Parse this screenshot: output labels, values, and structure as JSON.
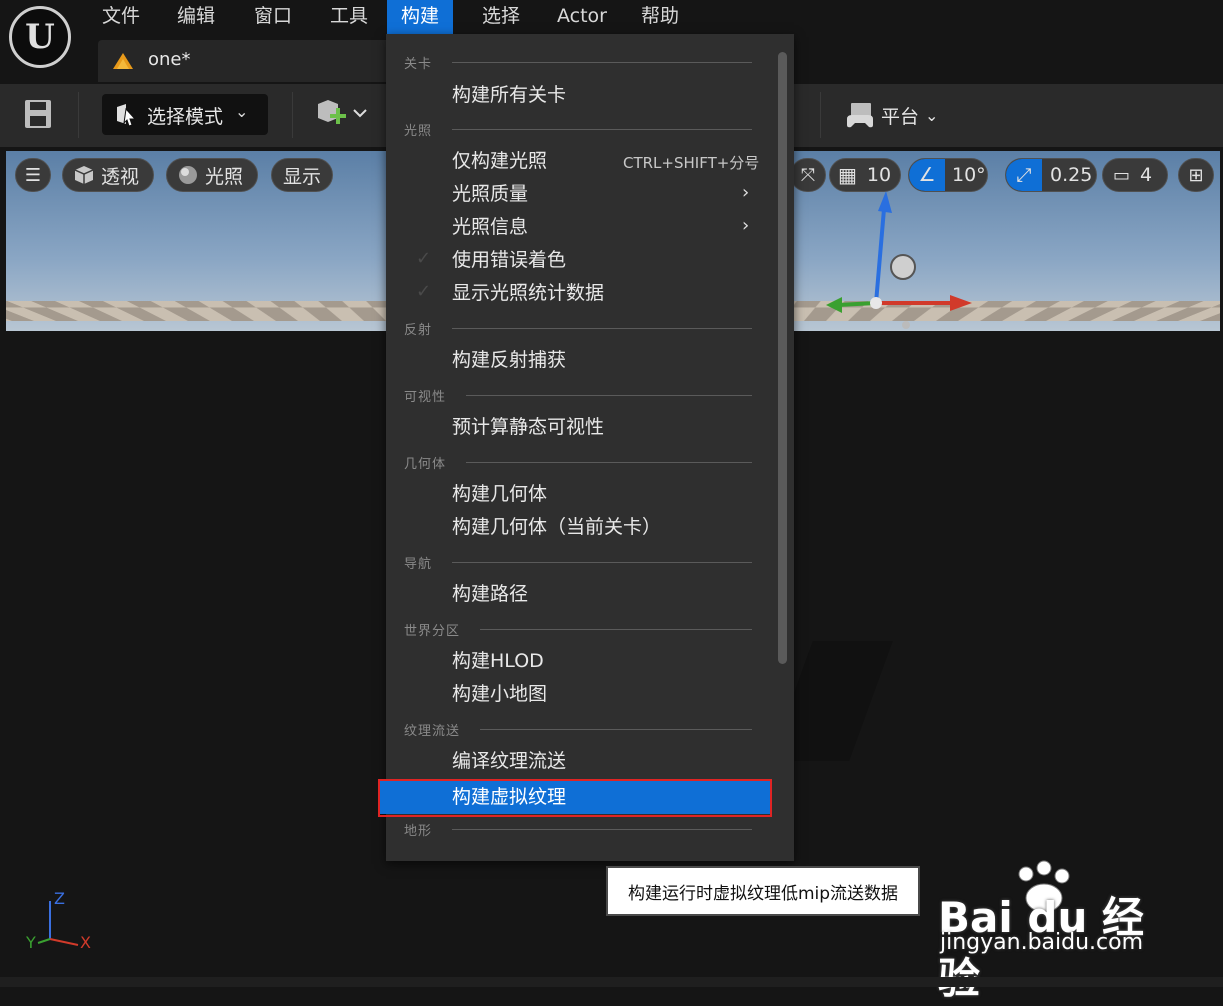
{
  "menubar": {
    "items": [
      "文件",
      "编辑",
      "窗口",
      "工具",
      "构建",
      "选择",
      "Actor",
      "帮助"
    ],
    "active": "构建"
  },
  "tab": {
    "title": "one*"
  },
  "toolbar": {
    "mode_label": "选择模式",
    "platform_label": "平台"
  },
  "viewport": {
    "perspective_label": "透视",
    "lighting_label": "光照",
    "show_label": "显示",
    "grid_value": "10",
    "angle_value": "10°",
    "scale_value": "0.25",
    "camera_speed": "4",
    "axis_labels": {
      "z": "Z",
      "y": "Y",
      "x": "X"
    }
  },
  "build_menu": {
    "sections": [
      {
        "title": "关卡",
        "items": [
          {
            "label": "构建所有关卡"
          }
        ]
      },
      {
        "title": "光照",
        "items": [
          {
            "label": "仅构建光照",
            "shortcut": "CTRL+SHIFT+分号"
          },
          {
            "label": "光照质量",
            "submenu": true
          },
          {
            "label": "光照信息",
            "submenu": true
          },
          {
            "label": "使用错误着色",
            "check": true
          },
          {
            "label": "显示光照统计数据",
            "check": true
          }
        ]
      },
      {
        "title": "反射",
        "items": [
          {
            "label": "构建反射捕获"
          }
        ]
      },
      {
        "title": "可视性",
        "items": [
          {
            "label": "预计算静态可视性"
          }
        ]
      },
      {
        "title": "几何体",
        "items": [
          {
            "label": "构建几何体"
          },
          {
            "label": "构建几何体（当前关卡）"
          }
        ]
      },
      {
        "title": "导航",
        "items": [
          {
            "label": "构建路径"
          }
        ]
      },
      {
        "title": "世界分区",
        "items": [
          {
            "label": "构建HLOD"
          },
          {
            "label": "构建小地图"
          }
        ]
      },
      {
        "title": "纹理流送",
        "items": [
          {
            "label": "编译纹理流送"
          },
          {
            "label": "构建虚拟纹理",
            "highlighted": true
          }
        ]
      },
      {
        "title": "地形",
        "items": []
      }
    ],
    "shortcut_prefix": "CTRL+SHIFT+分号"
  },
  "tooltip": {
    "text": "构建运行时虚拟纹理低mip流送数据"
  },
  "watermark": {
    "brand": "Bai du 经验",
    "url": "jingyan.baidu.com"
  },
  "colors": {
    "accent": "#0f6fd6",
    "highlight_border": "#e02424",
    "menu_bg": "#2f2f2f"
  }
}
